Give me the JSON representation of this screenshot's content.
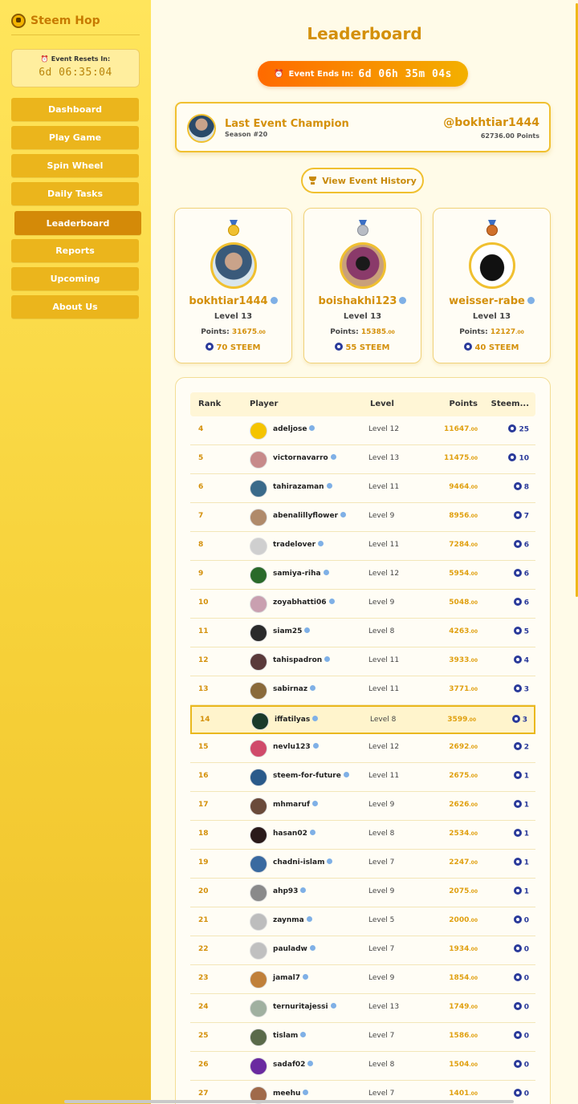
{
  "app": {
    "name": "Steem Hop"
  },
  "sidebar": {
    "reset_label": "Event Resets In:",
    "reset_time": "6d 06:35:04",
    "items": [
      {
        "label": "Dashboard",
        "active": false
      },
      {
        "label": "Play Game",
        "active": false
      },
      {
        "label": "Spin Wheel",
        "active": false
      },
      {
        "label": "Daily Tasks",
        "active": false
      },
      {
        "label": "Leaderboard",
        "active": true
      },
      {
        "label": "Reports",
        "active": false
      },
      {
        "label": "Upcoming",
        "active": false
      },
      {
        "label": "About Us",
        "active": false
      }
    ]
  },
  "main": {
    "title": "Leaderboard",
    "event_label": "Event Ends In:",
    "event_time": "6d 06h 35m 04s",
    "champion": {
      "title": "Last Event Champion",
      "season": "Season #20",
      "user": "@bokhtiar1444",
      "points": "62736.00 Points"
    },
    "history_button": "View Event History",
    "podium": [
      {
        "name": "bokhtiar1444",
        "level": "Level 13",
        "points_label": "Points:",
        "points": "31675",
        "dec": ".00",
        "steem": "70 STEEM",
        "medal": "gold"
      },
      {
        "name": "boishakhi123",
        "level": "Level 13",
        "points_label": "Points:",
        "points": "15385",
        "dec": ".00",
        "steem": "55 STEEM",
        "medal": "silver"
      },
      {
        "name": "weisser-rabe",
        "level": "Level 13",
        "points_label": "Points:",
        "points": "12127",
        "dec": ".00",
        "steem": "40 STEEM",
        "medal": "bronze"
      }
    ],
    "table": {
      "headers": {
        "rank": "Rank",
        "player": "Player",
        "level": "Level",
        "points": "Points",
        "steem": "Steem..."
      },
      "rows": [
        {
          "rank": "4",
          "player": "adeljose",
          "level": "Level 12",
          "points": "11647",
          "dec": ".00",
          "steem": "25"
        },
        {
          "rank": "5",
          "player": "victornavarro",
          "level": "Level 13",
          "points": "11475",
          "dec": ".00",
          "steem": "10"
        },
        {
          "rank": "6",
          "player": "tahirazaman",
          "level": "Level 11",
          "points": "9464",
          "dec": ".00",
          "steem": "8"
        },
        {
          "rank": "7",
          "player": "abenalillyflower",
          "level": "Level 9",
          "points": "8956",
          "dec": ".00",
          "steem": "7"
        },
        {
          "rank": "8",
          "player": "tradelover",
          "level": "Level 11",
          "points": "7284",
          "dec": ".00",
          "steem": "6"
        },
        {
          "rank": "9",
          "player": "samiya-riha",
          "level": "Level 12",
          "points": "5954",
          "dec": ".00",
          "steem": "6"
        },
        {
          "rank": "10",
          "player": "zoyabhatti06",
          "level": "Level 9",
          "points": "5048",
          "dec": ".00",
          "steem": "6"
        },
        {
          "rank": "11",
          "player": "siam25",
          "level": "Level 8",
          "points": "4263",
          "dec": ".00",
          "steem": "5"
        },
        {
          "rank": "12",
          "player": "tahispadron",
          "level": "Level 11",
          "points": "3933",
          "dec": ".00",
          "steem": "4"
        },
        {
          "rank": "13",
          "player": "sabirnaz",
          "level": "Level 11",
          "points": "3771",
          "dec": ".00",
          "steem": "3"
        },
        {
          "rank": "14",
          "player": "iffatilyas",
          "level": "Level 8",
          "points": "3599",
          "dec": ".00",
          "steem": "3",
          "highlight": true
        },
        {
          "rank": "15",
          "player": "nevlu123",
          "level": "Level 12",
          "points": "2692",
          "dec": ".00",
          "steem": "2"
        },
        {
          "rank": "16",
          "player": "steem-for-future",
          "level": "Level 11",
          "points": "2675",
          "dec": ".00",
          "steem": "1"
        },
        {
          "rank": "17",
          "player": "mhmaruf",
          "level": "Level 9",
          "points": "2626",
          "dec": ".00",
          "steem": "1"
        },
        {
          "rank": "18",
          "player": "hasan02",
          "level": "Level 8",
          "points": "2534",
          "dec": ".00",
          "steem": "1"
        },
        {
          "rank": "19",
          "player": "chadni-islam",
          "level": "Level 7",
          "points": "2247",
          "dec": ".00",
          "steem": "1"
        },
        {
          "rank": "20",
          "player": "ahp93",
          "level": "Level 9",
          "points": "2075",
          "dec": ".00",
          "steem": "1"
        },
        {
          "rank": "21",
          "player": "zaynma",
          "level": "Level 5",
          "points": "2000",
          "dec": ".00",
          "steem": "0"
        },
        {
          "rank": "22",
          "player": "pauladw",
          "level": "Level 7",
          "points": "1934",
          "dec": ".00",
          "steem": "0"
        },
        {
          "rank": "23",
          "player": "jamal7",
          "level": "Level 9",
          "points": "1854",
          "dec": ".00",
          "steem": "0"
        },
        {
          "rank": "24",
          "player": "ternuritajessi",
          "level": "Level 13",
          "points": "1749",
          "dec": ".00",
          "steem": "0"
        },
        {
          "rank": "25",
          "player": "tislam",
          "level": "Level 7",
          "points": "1586",
          "dec": ".00",
          "steem": "0"
        },
        {
          "rank": "26",
          "player": "sadaf02",
          "level": "Level 8",
          "points": "1504",
          "dec": ".00",
          "steem": "0"
        },
        {
          "rank": "27",
          "player": "meehu",
          "level": "Level 7",
          "points": "1401",
          "dec": ".00",
          "steem": "0"
        }
      ]
    }
  },
  "colors": {
    "accent": "#d4900a",
    "nav_bg": "#ebb51c",
    "nav_active": "#d48a08",
    "gold": "#f0c030",
    "silver": "#b8bcc4",
    "bronze": "#d0702a",
    "steem": "#2a3a9a"
  },
  "icons": {
    "brand": "hop-logo-icon",
    "clock": "alarm-clock-icon",
    "trophy": "trophy-icon",
    "info": "info-icon",
    "steem": "steem-coin-icon"
  }
}
